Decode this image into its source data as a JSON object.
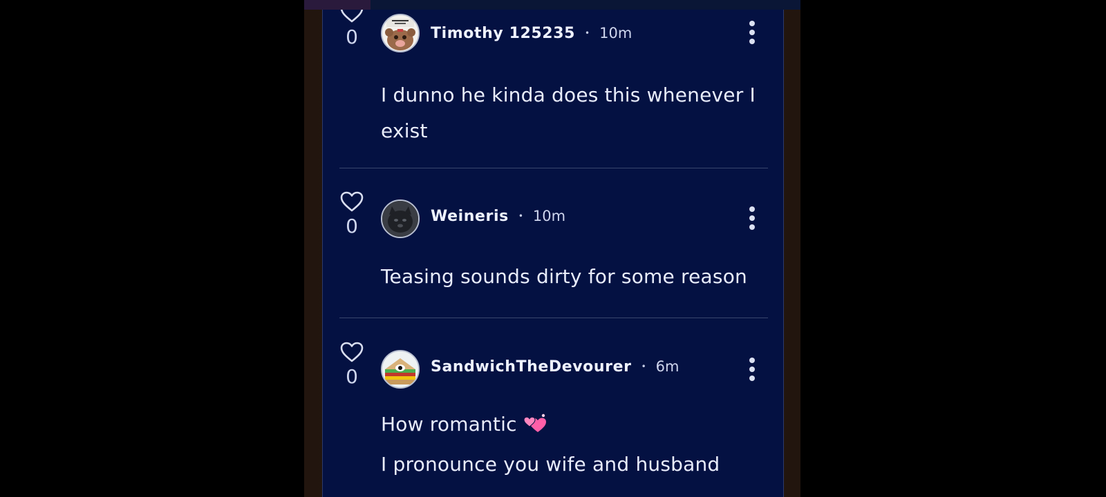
{
  "comments": [
    {
      "author": "Timothy 125235",
      "time": "10m",
      "likes": "0",
      "text_lines": [
        "I dunno he kinda does this whenever I",
        "exist"
      ],
      "avatar_icon": "bear-avatar-icon"
    },
    {
      "author": "Weineris",
      "time": "10m",
      "likes": "0",
      "text_lines": [
        "Teasing sounds dirty for some reason"
      ],
      "avatar_icon": "cat-avatar-icon"
    },
    {
      "author": "SandwichTheDevourer",
      "time": "6m",
      "likes": "0",
      "text_lines": [
        "How romantic",
        "I pronounce you wife and husband"
      ],
      "avatar_icon": "sandwich-avatar-icon",
      "emoji": "revolving-hearts-icon"
    }
  ],
  "separator": "•",
  "colors": {
    "panel_bg": "#041142",
    "text": "#e8ecfb",
    "divider": "#39456d",
    "heart_emoji": "#ff5fa8"
  }
}
